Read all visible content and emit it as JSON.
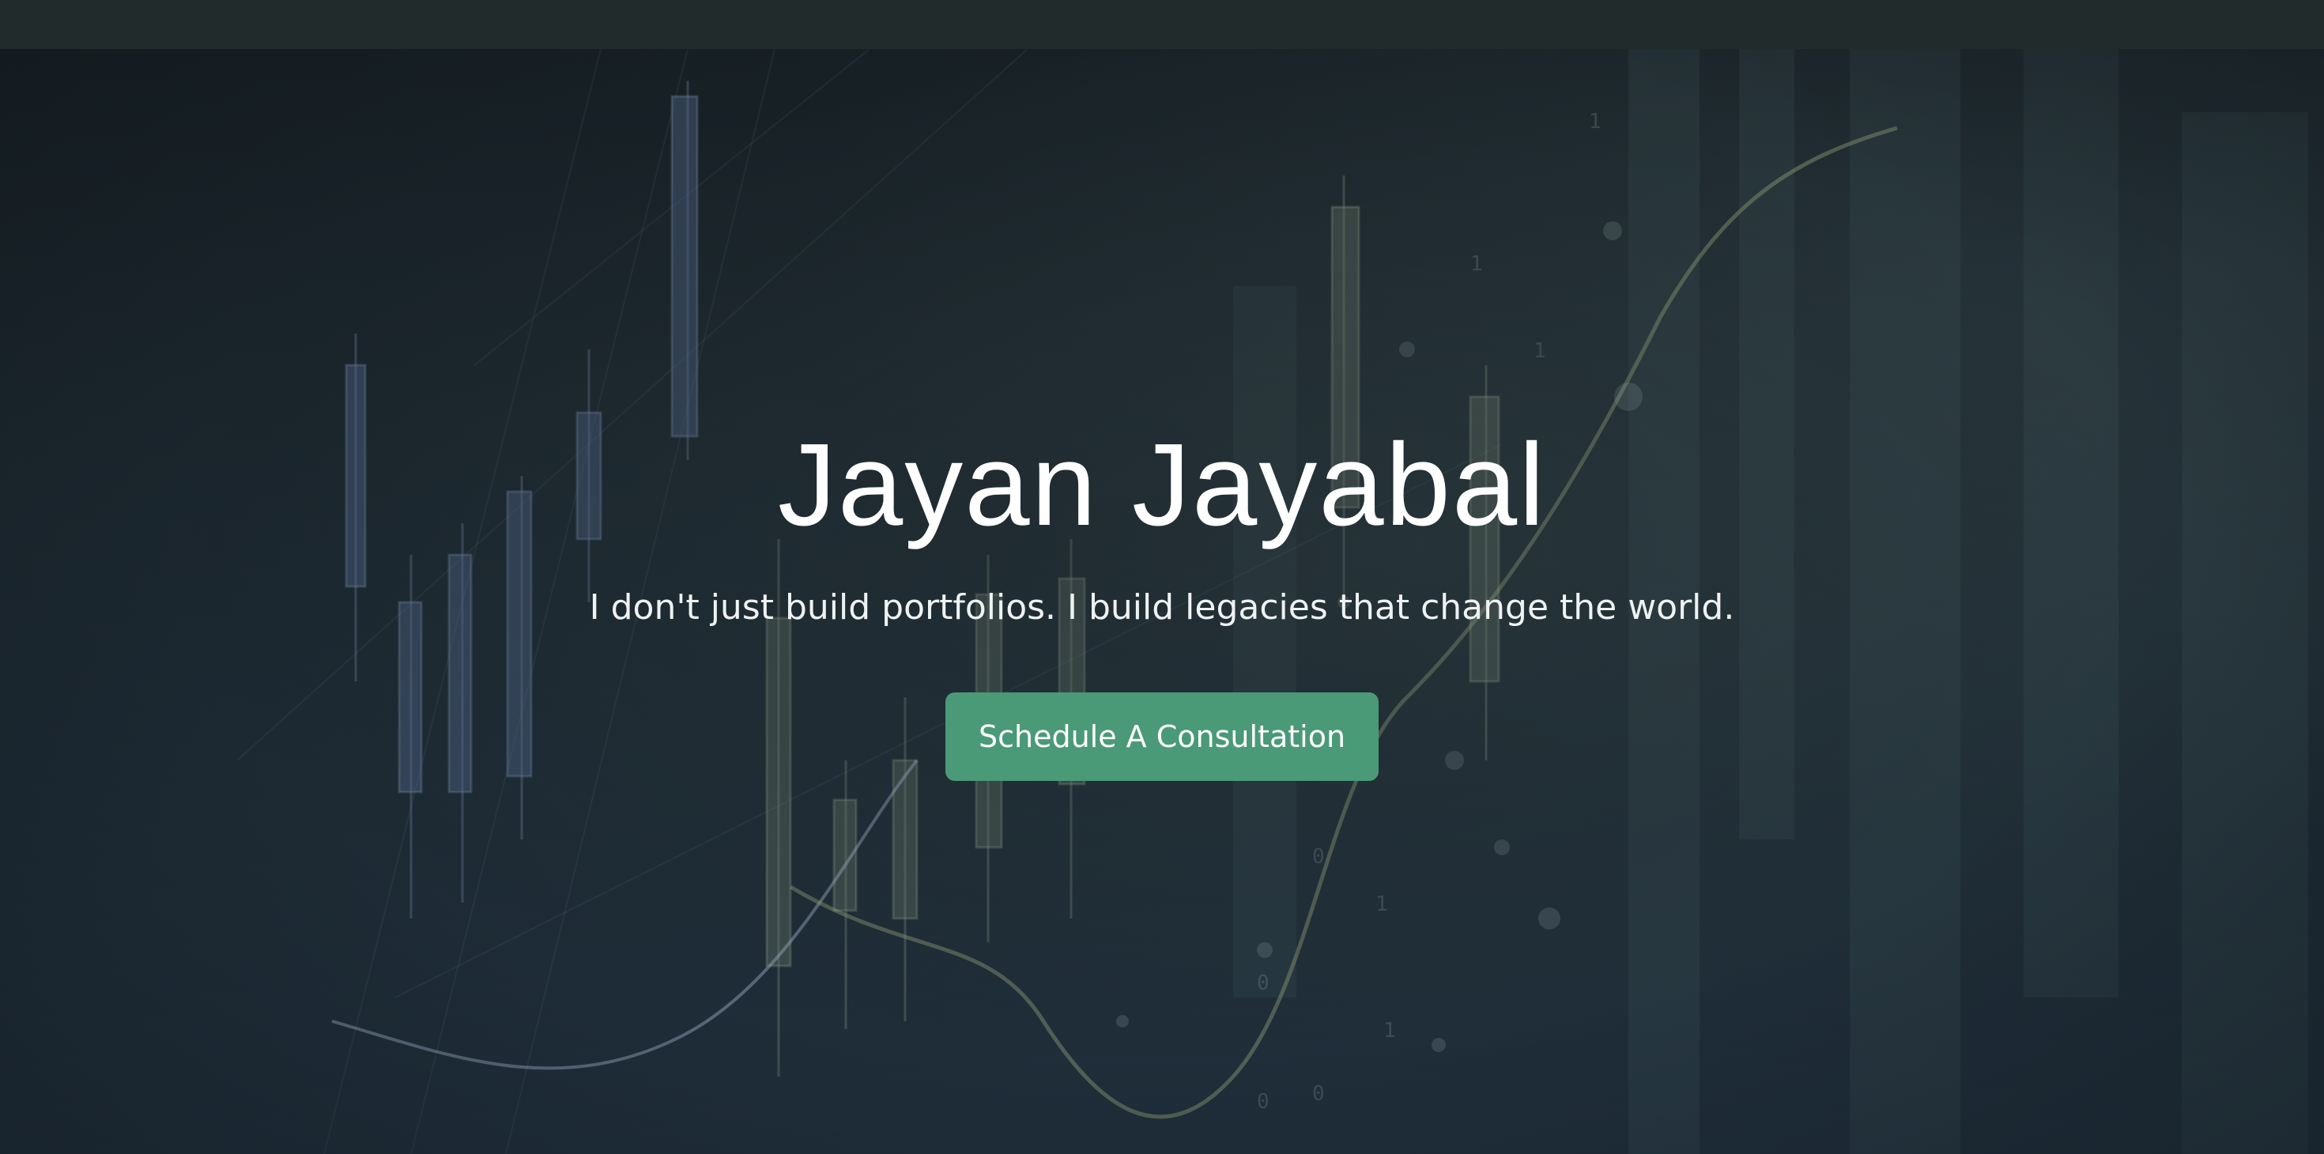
{
  "hero": {
    "title": "Jayan Jayabal",
    "subtitle": "I don't just build portfolios. I build legacies that change the world.",
    "cta_label": "Schedule A Consultation",
    "background_image": "financial-candlestick-chart"
  },
  "colors": {
    "top_bar": "#222b2c",
    "hero_background": "#1d2a33",
    "cta_background": "#4a9a77",
    "text": "#ffffff"
  }
}
